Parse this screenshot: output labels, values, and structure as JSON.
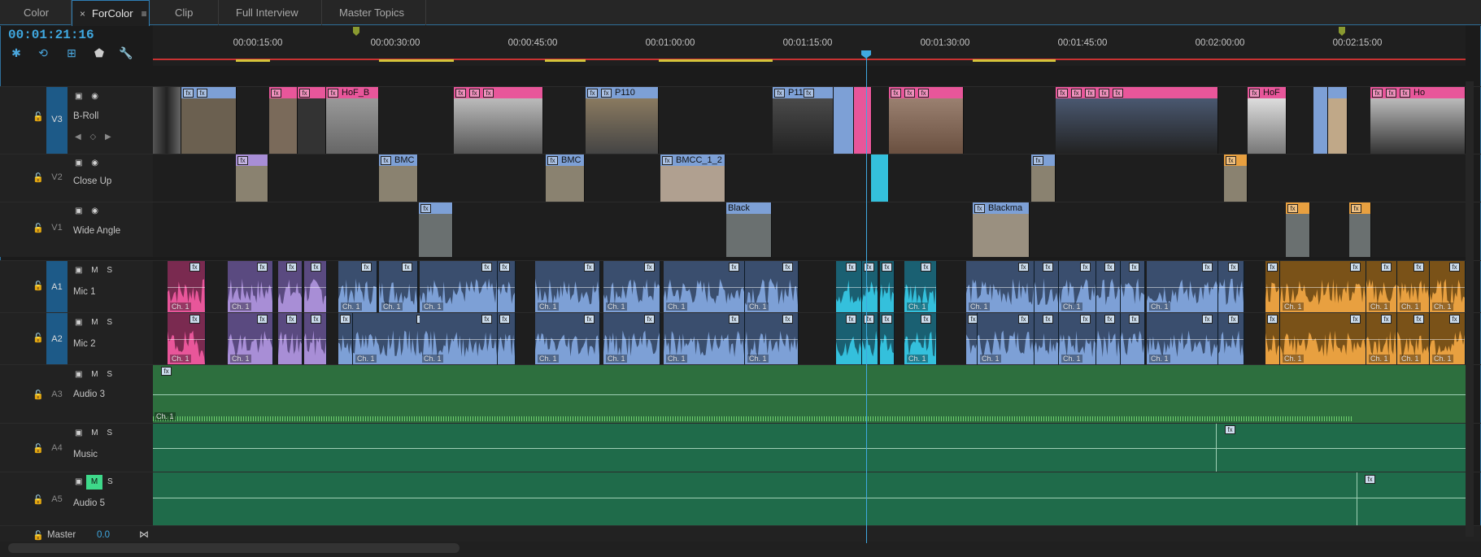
{
  "tabs": [
    {
      "label": "Color",
      "active": false
    },
    {
      "label": "ForColor",
      "active": true
    },
    {
      "label": "Clip",
      "active": false
    },
    {
      "label": "Full Interview",
      "active": false
    },
    {
      "label": "Master Topics",
      "active": false
    }
  ],
  "timecode": "00:01:21:16",
  "ruler": {
    "labels": [
      "00:00:15:00",
      "00:00:30:00",
      "00:00:45:00",
      "00:01:00:00",
      "00:01:15:00",
      "00:01:30:00",
      "00:01:45:00",
      "00:02:00:00",
      "00:02:15:00"
    ]
  },
  "tracks": {
    "v3": {
      "id": "V3",
      "name": "B-Roll"
    },
    "v2": {
      "id": "V2",
      "name": "Close Up"
    },
    "v1": {
      "id": "V1",
      "name": "Wide Angle"
    },
    "a1": {
      "id": "A1",
      "name": "Mic 1"
    },
    "a2": {
      "id": "A2",
      "name": "Mic 2"
    },
    "a3": {
      "id": "A3",
      "name": "Audio 3"
    },
    "a4": {
      "id": "A4",
      "name": "Music"
    },
    "a5": {
      "id": "A5",
      "name": "Audio 5"
    },
    "master": {
      "label": "Master",
      "value": "0.0"
    }
  },
  "clip_labels": {
    "hof_b": "HoF_B",
    "p110": "P110",
    "p11": "P11",
    "hof": "HoF",
    "ho": "Ho",
    "bmc1": "BMC",
    "bmc2": "BMC",
    "bmcc": "BMCC_1_2",
    "black": "Black",
    "blackma": "Blackma",
    "ch1": "Ch. 1"
  },
  "colors": {
    "accent": "#3fa8e0",
    "pink": "#e8569a",
    "blue": "#7da0d6",
    "cyan": "#34c0dc",
    "orange": "#e8a040",
    "purple": "#a88ed6",
    "green": "#1f6b45"
  }
}
